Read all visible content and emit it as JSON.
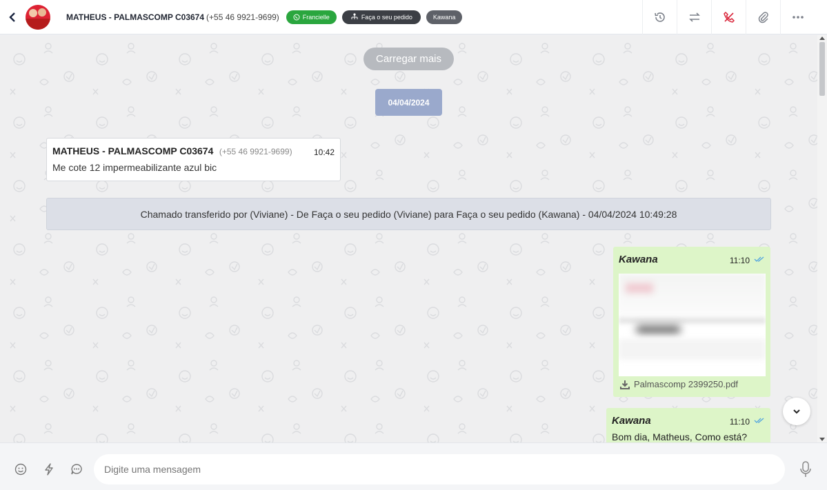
{
  "header": {
    "contact_name": "MATHEUS - PALMASCOMP C03674",
    "contact_phone": "(+55 46 9921-9699)",
    "tags": {
      "channel": "Francielle",
      "queue": "Faça o seu pedido",
      "agent": "Kawana"
    },
    "icons": [
      "back-icon",
      "history-icon",
      "transfer-icon",
      "end-call-icon",
      "attach-icon",
      "more-icon"
    ]
  },
  "chat": {
    "load_more": "Carregar mais",
    "date": "04/04/2024",
    "incoming": {
      "sender": "MATHEUS - PALMASCOMP C03674",
      "phone": "(+55 46 9921-9699)",
      "time": "10:42",
      "text": "Me cote 12 impermeabilizante azul bic"
    },
    "system": "Chamado transferido por (Viviane) - De Faça o seu pedido (Viviane) para Faça o seu pedido (Kawana) - 04/04/2024 10:49:28",
    "outgoing_file": {
      "sender": "Kawana",
      "time": "11:10",
      "filename": "Palmascomp 2399250.pdf"
    },
    "outgoing_text": {
      "sender": "Kawana",
      "time": "11:10",
      "text": "Bom dia, Matheus, Como está?"
    }
  },
  "composer": {
    "placeholder": "Digite uma mensagem"
  },
  "colors": {
    "green_tag": "#2aa63e",
    "dark_tag": "#3c3f45",
    "date_chip": "#9aa9cc",
    "outgoing_bubble": "#ddf5c8",
    "read_ticks": "#4fa3e0"
  }
}
